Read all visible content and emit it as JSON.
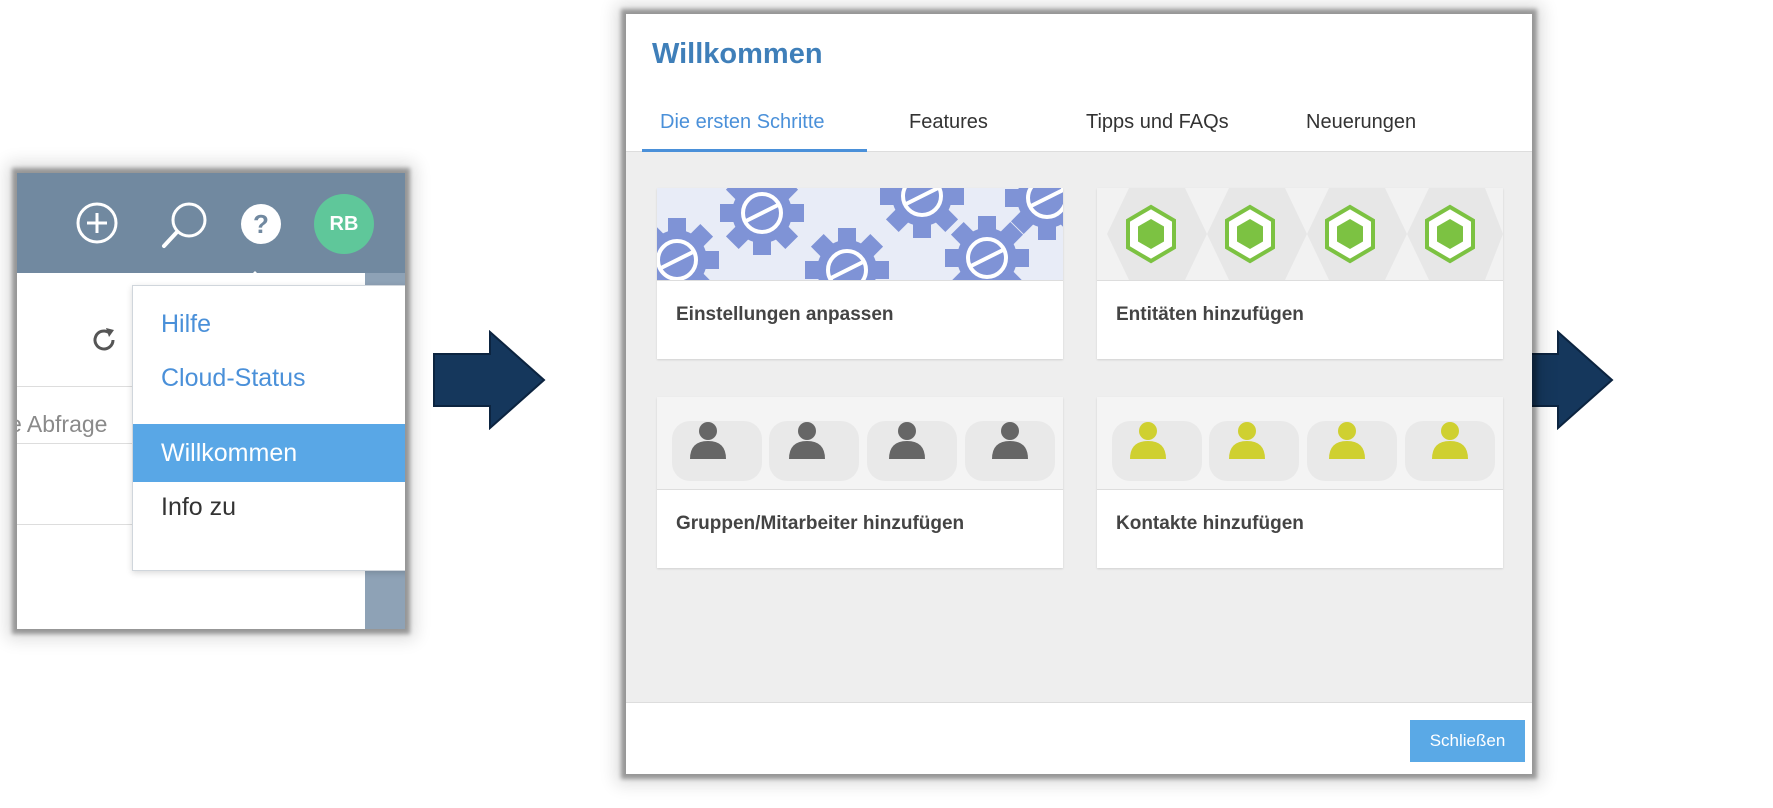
{
  "header": {
    "avatar_initials": "RB",
    "help_glyph": "?"
  },
  "dropdown": {
    "items": [
      {
        "label": "Hilfe"
      },
      {
        "label": "Cloud-Status"
      },
      {
        "label": "Willkommen",
        "active": true
      },
      {
        "label": "Info zu"
      }
    ]
  },
  "background": {
    "query_text": "e Abfrage"
  },
  "dialog": {
    "title": "Willkommen",
    "tabs": [
      {
        "label": "Die ersten Schritte",
        "active": true
      },
      {
        "label": "Features"
      },
      {
        "label": "Tipps und FAQs"
      },
      {
        "label": "Neuerungen"
      }
    ],
    "cards": [
      {
        "label": "Einstellungen anpassen",
        "image": "gears-pattern"
      },
      {
        "label": "Entitäten hinzufügen",
        "image": "green-hexagons"
      },
      {
        "label": "Gruppen/Mitarbeiter hinzufügen",
        "image": "gray-person-icons"
      },
      {
        "label": "Kontakte hinzufügen",
        "image": "yellow-person-icons"
      }
    ],
    "close_label": "Schließen"
  },
  "icons": [
    "plus-circle-icon",
    "search-icon",
    "help-icon",
    "refresh-icon",
    "right-arrow-icon",
    "gear-icon",
    "hexagon-icon",
    "person-icon"
  ],
  "colors": {
    "topbar": "#7189a0",
    "avatar": "#5fc79a",
    "accent": "#4a90d9",
    "active_item": "#59a7e6",
    "arrow": "#15375c",
    "gear": "#7f93d6",
    "hexagon": "#7cc242",
    "person_gray": "#666666",
    "person_yellow": "#cfd030"
  }
}
